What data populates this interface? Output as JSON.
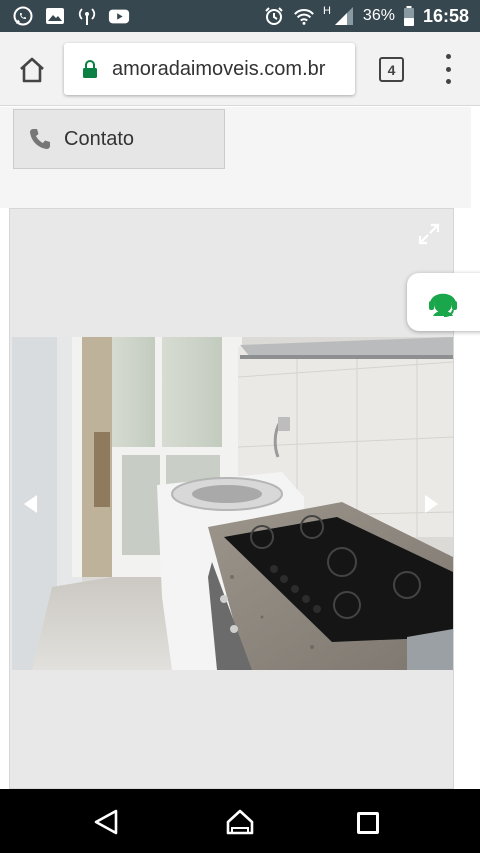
{
  "status_bar": {
    "battery": "36%",
    "time": "16:58",
    "network_type": "H",
    "left_icons": [
      "whatsapp-icon",
      "gallery-icon",
      "hotspot-icon",
      "youtube-icon"
    ],
    "right_icons": [
      "alarm-icon",
      "wifi-icon",
      "signal-icon",
      "battery-icon"
    ]
  },
  "browser": {
    "url": "amoradaimoveis.com.br",
    "tab_count": "4",
    "secure": true,
    "accent_color": "#0b8043"
  },
  "page": {
    "contact_button": {
      "label": "Contato",
      "icon": "phone-icon"
    },
    "gallery": {
      "expand_icon": "expand-icon",
      "prev_icon": "arrow-left-icon",
      "next_icon": "arrow-right-icon"
    },
    "chat_widget": {
      "icon": "chat-agent-icon",
      "color": "#1aa64a"
    }
  },
  "nav_bar": {
    "buttons": [
      "back",
      "home",
      "recents"
    ]
  }
}
